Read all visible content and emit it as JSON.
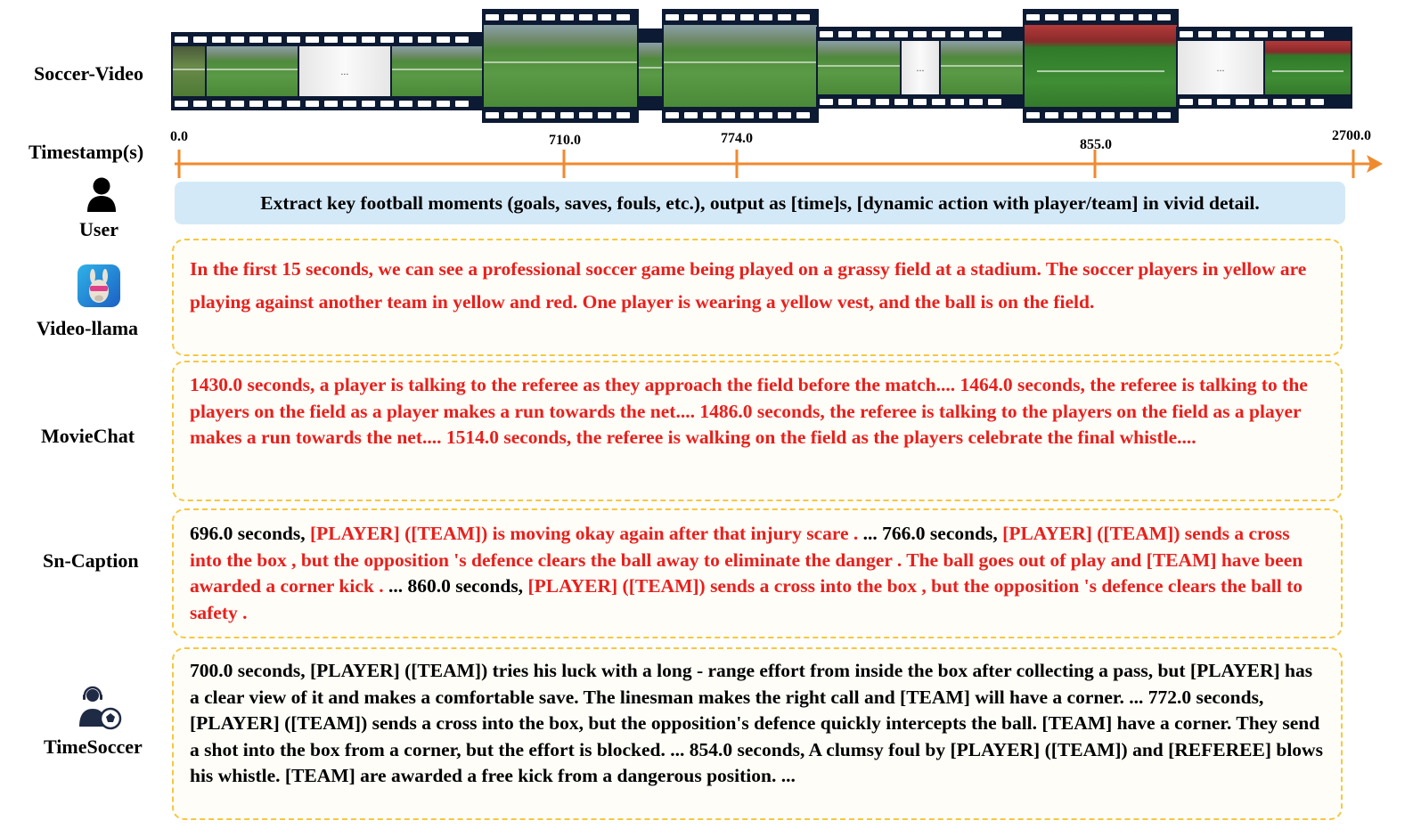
{
  "row_labels": {
    "video": "Soccer-Video",
    "timestamp": "Timestamp(s)",
    "user": "User",
    "videollama": "Video-llama",
    "moviechat": "MovieChat",
    "sncaption": "Sn-Caption",
    "timesoccer": "TimeSoccer"
  },
  "timeline": {
    "ticks": [
      "0.0",
      "710.0",
      "774.0",
      "855.0",
      "2700.0"
    ],
    "color": "#f08a2e"
  },
  "ellipsis": "...",
  "user_prompt": "Extract key football moments (goals, saves, fouls, etc.), output as [time]s, [dynamic action with player/team] in vivid detail.",
  "videollama_text": "In the first 15 seconds, we can see a professional soccer game being played on a grassy field at a stadium. The soccer players in yellow are playing against another team in yellow and red. One player is wearing a yellow vest, and the ball is on the field.",
  "moviechat_text": "1430.0 seconds, a player is talking to the referee as they approach the field before the match.... 1464.0 seconds, the referee is talking to the players on the field as a player makes a run towards the net.... 1486.0 seconds, the referee is talking to the players on the field as a player makes a run towards the net.... 1514.0 seconds, the referee is walking on the field as the players celebrate the final whistle....",
  "sncaption": {
    "t1": "696.0 seconds, ",
    "r1": "[PLAYER] ([TEAM]) is moving okay again after that injury scare . ",
    "t2": "... 766.0 seconds, ",
    "r2": "[PLAYER] ([TEAM]) sends a cross into the box , but the opposition 's defence clears the ball away to eliminate the danger .  The ball goes out of play and [TEAM] have been awarded a corner kick . ",
    "t3": "... 860.0 seconds, ",
    "r3": "[PLAYER] ([TEAM]) sends a cross into the box , but the opposition 's defence clears the ball to safety ."
  },
  "timesoccer_text": "700.0 seconds, [PLAYER] ([TEAM]) tries his luck with a long - range effort from inside the box after collecting a pass, but [PLAYER] has a clear view of it and makes a comfortable save. The linesman makes the right call and [TEAM] will have a corner. ... 772.0 seconds, [PLAYER] ([TEAM]) sends a cross into the box, but the opposition's defence quickly intercepts the ball. [TEAM] have a corner. They send a shot into the box from a corner, but the effort is blocked. ... 854.0 seconds, A clumsy foul by [PLAYER] ([TEAM]) and [REFEREE] blows his whistle. [TEAM] are awarded a free kick from a dangerous position. ...",
  "colors": {
    "highlight_red": "#e8201c",
    "box_border": "#f5c842",
    "prompt_bg": "#d4e9f7",
    "film": "#0d1a33"
  },
  "icons": [
    "user-icon",
    "llama-icon",
    "soccer-agent-icon"
  ]
}
